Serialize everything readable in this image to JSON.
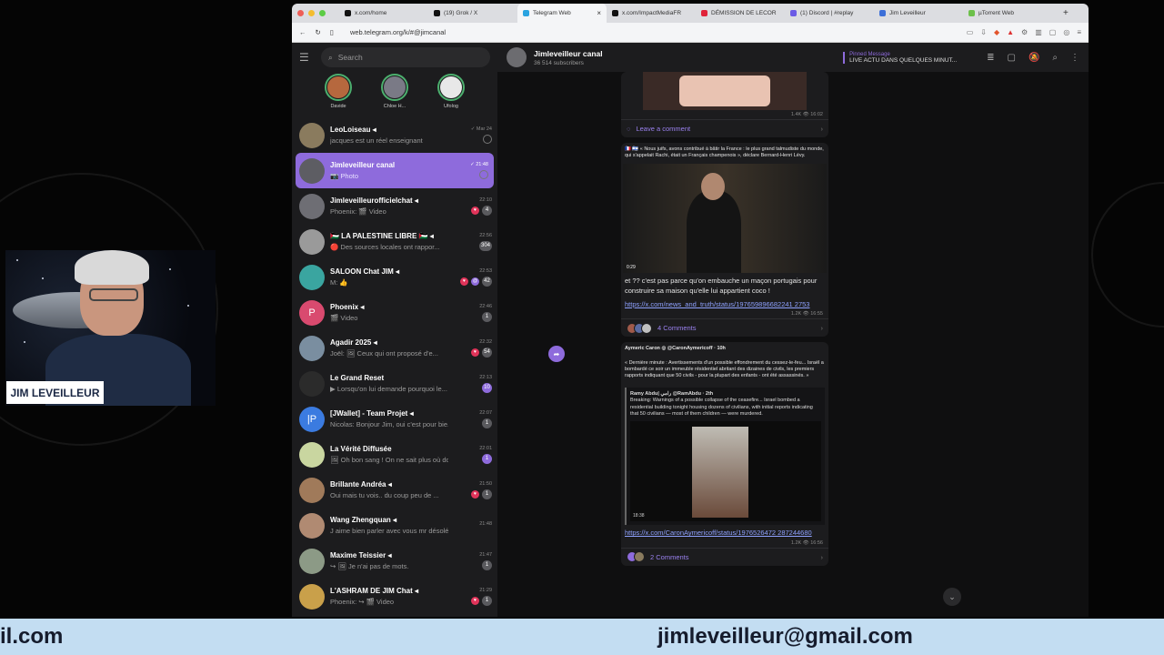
{
  "webcam": {
    "name_label": "JIM LEVEILLEUR"
  },
  "browser": {
    "tabs": [
      {
        "label": "x.com/home",
        "color": "#111111"
      },
      {
        "label": "(19) Grok / X",
        "color": "#111111"
      },
      {
        "label": "Telegram Web",
        "color": "#2aa3e0",
        "active": true
      },
      {
        "label": "x.com/ImpactMediaFR",
        "color": "#111111"
      },
      {
        "label": "DÉMISSION DE LECOR",
        "color": "#e0243a"
      },
      {
        "label": "(1) Discord | #replay",
        "color": "#6b5be6"
      },
      {
        "label": "Jim Leveilleur",
        "color": "#3c6fd8"
      },
      {
        "label": "µTorrent Web",
        "color": "#6cc04a"
      }
    ],
    "new_tab": "+",
    "close_tab": "×",
    "url": "web.telegram.org/k/#@jimcanal"
  },
  "sidebar": {
    "search_placeholder": "Search",
    "stories": [
      {
        "name": "Davide",
        "color": "#b6683e"
      },
      {
        "name": "Chloe H...",
        "color": "#7a7a86"
      },
      {
        "name": "Ufolog",
        "color": "#e8e8e8"
      }
    ],
    "chats": [
      {
        "name": "LeoLoiseau ◂",
        "preview": "jacques est un réel enseignant",
        "time": "✓ Mar 24",
        "badge": "",
        "heart": false,
        "pin": true,
        "avatar": "#8a7b5e",
        "letter": ""
      },
      {
        "name": "Jimleveilleur canal",
        "preview": "📷 Photo",
        "time": "✓ 21:48",
        "badge": "",
        "heart": false,
        "pin": true,
        "active": true,
        "avatar": "#5d5d63",
        "letter": ""
      },
      {
        "name": "Jimleveilleurofficielchat ◂",
        "preview": "Phoenix: 🎬 Video",
        "time": "22:10",
        "badge": "4",
        "heart": true,
        "avatar": "#6e6e74",
        "letter": ""
      },
      {
        "name": "🇵🇸 LA PALESTINE LIBRE 🇵🇸 ◂",
        "preview": "🔴 Des sources locales ont rappor...",
        "time": "22:56",
        "badge": "304",
        "heart": false,
        "avatar": "#9a9a9a",
        "letter": ""
      },
      {
        "name": "SALOON Chat JIM ◂",
        "preview": "M: 👍",
        "time": "22:53",
        "badge": "42",
        "heart": true,
        "extra": true,
        "avatar": "#3aa5a0",
        "letter": ""
      },
      {
        "name": "Phoenix ◂",
        "preview": "🎬 Video",
        "time": "22:46",
        "badge": "1",
        "heart": false,
        "avatar": "#d94a6f",
        "letter": "P"
      },
      {
        "name": "Agadir 2025 ◂",
        "preview": "Joël: 🖼 Ceux qui ont proposé d'e...",
        "time": "22:32",
        "badge": "54",
        "heart": true,
        "avatar": "#7a8ea0",
        "letter": ""
      },
      {
        "name": "Le Grand Reset",
        "preview": "▶ Lorsqu'on lui demande pourquoi le...",
        "time": "22:13",
        "badge": "10",
        "heart": false,
        "purple": true,
        "avatar": "#2b2b2b",
        "letter": ""
      },
      {
        "name": "[JWallet] - Team Projet ◂",
        "preview": "Nicolas: Bonjour Jim, oui c'est pour bie...",
        "time": "22:07",
        "badge": "1",
        "heart": false,
        "avatar": "#3b7be0",
        "letter": "|P"
      },
      {
        "name": "La Vérité Diffusée",
        "preview": "🖼 Oh bon sang ! On ne sait plus où do...",
        "time": "22:01",
        "badge": "1",
        "heart": false,
        "purple": true,
        "avatar": "#c9d6a0",
        "letter": ""
      },
      {
        "name": "Brillante Andréa ◂",
        "preview": "Oui mais tu vois.. du coup peu de ...",
        "time": "21:50",
        "badge": "1",
        "heart": true,
        "avatar": "#a07a5a",
        "letter": ""
      },
      {
        "name": "Wang Zhengquan ◂",
        "preview": "J aime bien parler avec vous mr désolée",
        "time": "21:48",
        "badge": "",
        "heart": false,
        "avatar": "#b08a72",
        "letter": ""
      },
      {
        "name": "Maxime Teissier ◂",
        "preview": "↪ 🖼 Je n'ai pas de mots.",
        "time": "21:47",
        "badge": "1",
        "heart": false,
        "avatar": "#8c9a86",
        "letter": ""
      },
      {
        "name": "L'ASHRAM DE JIM Chat ◂",
        "preview": "Phoenix: ↪ 🎬 Video",
        "time": "21:29",
        "badge": "1",
        "heart": true,
        "avatar": "#c9a04a",
        "letter": ""
      }
    ]
  },
  "channel": {
    "title": "Jimleveilleur canal",
    "subscribers": "36 514 subscribers",
    "pinned_label": "Pinned Message",
    "pinned_text": "LIVE ACTU DANS QUELQUES MINUT...",
    "posts": [
      {
        "meta": "1.4K 👁 16:02",
        "comment_label": "Leave a comment"
      },
      {
        "header": "🇫🇷 🇮🇱 « Nous juifs, avons contribué à bâtir la France : le plus grand talmudiste du monde, qui s'appelait Rachi, était un Français champenois », déclare Bernard-Henri Lévy.",
        "video_time": "0:29",
        "caption": "et ?? c'est pas parce qu'on embauche un maçon portugais pour construire sa maison qu'elle lui appartient coco !",
        "link": "https://x.com/news_and_truth/status/197659896682241 2753",
        "meta": "1.2K 👁 16:55",
        "comments": "4 Comments"
      },
      {
        "header": "Aymeric Caron ◎ @CaronAymericoff · 10h",
        "body": "« Dernière minute : Avertissements d'un possible effondrement du cessez-le-feu... Israël a bombardé ce soir un immeuble résidentiel abritant des dizaines de civils, les premiers rapports indiquant que 50 civils - pour la plupart des enfants - ont été assassinés. »",
        "quote_author": "Ramy Abdu| رامي @RamAbdu · 2th",
        "quote_text": "Breaking: Warnings of a possible collapse of the ceasefire... Israel bombed a residential building tonight housing dozens of civilians, with initial reports indicating that 50 civilians — most of them children — were murdered.",
        "video_time": "18:38",
        "link": "https://x.com/CaronAymericoff/status/1976526472 287244680",
        "meta": "1.2K 👁 16:56",
        "comments": "2 Comments"
      }
    ]
  },
  "footer": {
    "left": "il.com",
    "right": "jimleveilleur@gmail.com"
  }
}
